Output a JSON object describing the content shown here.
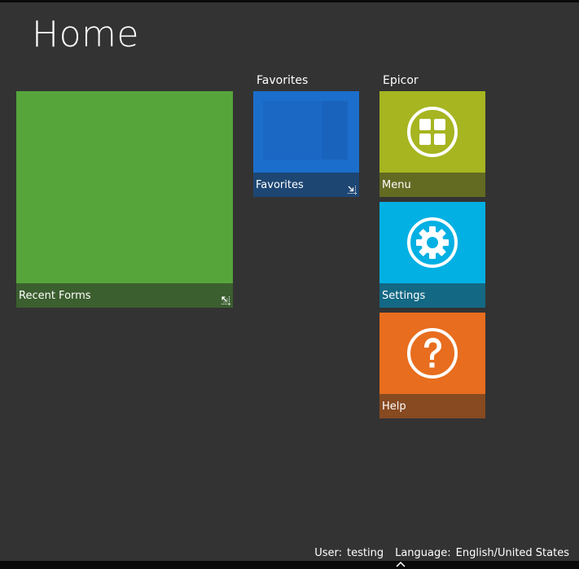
{
  "page": {
    "title": "Home"
  },
  "groups": {
    "favorites_header": "Favorites",
    "epicor_header": "Epicor"
  },
  "tiles": {
    "recent_forms": {
      "label": "Recent Forms",
      "color": "#56a53b",
      "bar_color": "#3b5f2f",
      "icon": "resize-icon"
    },
    "favorites": {
      "label": "Favorites",
      "color": "#1b6ecb",
      "bar_color": "#1d4673",
      "icon": "resize-icon"
    },
    "menu": {
      "label": "Menu",
      "color": "#a6b520",
      "bar_color": "#636a22",
      "icon": "grid-icon"
    },
    "settings": {
      "label": "Settings",
      "color": "#03b0e3",
      "bar_color": "#136884",
      "icon": "gear-icon"
    },
    "help": {
      "label": "Help",
      "color": "#e86d1e",
      "bar_color": "#874a21",
      "icon": "help-icon"
    }
  },
  "status": {
    "user_label": "User:",
    "user_value": "testing",
    "language_label": "Language:",
    "language_value": "English/United States"
  }
}
